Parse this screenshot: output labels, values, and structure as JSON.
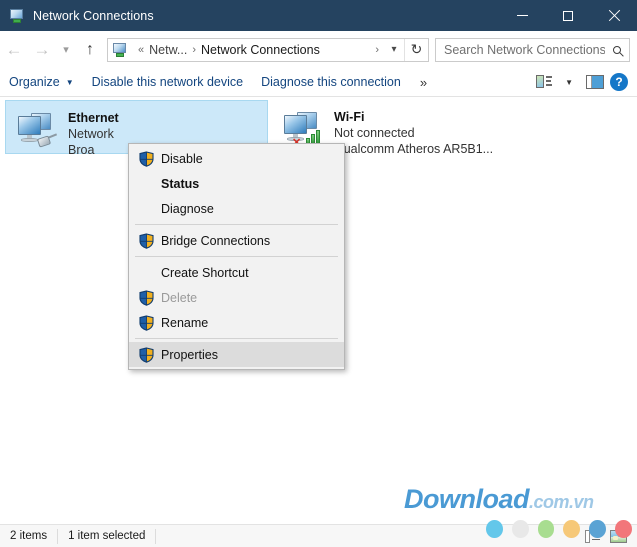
{
  "window": {
    "title": "Network Connections",
    "icon": "network-computer-icon",
    "minimize_label": "Minimize",
    "maximize_label": "Maximize",
    "close_label": "Close"
  },
  "nav": {
    "back": "back-arrow",
    "forward": "forward-arrow",
    "recent": "recent-locations-chevron",
    "up": "up-arrow",
    "breadcrumb_separator_1": "«",
    "breadcrumb_1": "Netw...",
    "breadcrumb_separator_2": "›",
    "breadcrumb_2": "Network Connections",
    "dropdown": "chevron-down-icon",
    "refresh": "refresh-icon"
  },
  "search": {
    "placeholder": "Search Network Connections",
    "value": "",
    "icon": "search-icon"
  },
  "toolbar": {
    "organize_label": "Organize",
    "disable_label": "Disable this network device",
    "diagnose_label": "Diagnose this connection",
    "overflow_label": "»",
    "view_options_label": "Change your view",
    "preview_pane_label": "Preview pane",
    "help_label": "?"
  },
  "connections": [
    {
      "name": "Ethernet",
      "status": "Network",
      "device": "Broa",
      "icon": "ethernet-connection-icon",
      "selected": true
    },
    {
      "name": "Wi-Fi",
      "status": "Not connected",
      "device": "Qualcomm Atheros AR5B1...",
      "icon": "wifi-connection-icon",
      "selected": false
    }
  ],
  "context_menu": {
    "items": [
      {
        "label": "Disable",
        "shield": true,
        "bold": false,
        "disabled": false,
        "hover": false
      },
      {
        "label": "Status",
        "shield": false,
        "bold": true,
        "disabled": false,
        "hover": false
      },
      {
        "label": "Diagnose",
        "shield": false,
        "bold": false,
        "disabled": false,
        "hover": false
      },
      {
        "separator": true
      },
      {
        "label": "Bridge Connections",
        "shield": true,
        "bold": false,
        "disabled": false,
        "hover": false
      },
      {
        "separator": true
      },
      {
        "label": "Create Shortcut",
        "shield": false,
        "bold": false,
        "disabled": false,
        "hover": false
      },
      {
        "label": "Delete",
        "shield": true,
        "bold": false,
        "disabled": true,
        "hover": false
      },
      {
        "label": "Rename",
        "shield": true,
        "bold": false,
        "disabled": false,
        "hover": false
      },
      {
        "separator": true
      },
      {
        "label": "Properties",
        "shield": true,
        "bold": false,
        "disabled": false,
        "hover": true
      }
    ]
  },
  "statusbar": {
    "item_count": "2 items",
    "selection": "1 item selected",
    "details_view_icon": "details-view-icon",
    "tiles_view_icon": "large-icons-view-icon"
  },
  "watermark": {
    "main": "Download",
    "sub": ".com.vn",
    "dots": [
      "#63c7ea",
      "#e8e8e8",
      "#a8dd90",
      "#f6c878",
      "#5aa3d4",
      "#f2767a"
    ]
  },
  "colors": {
    "titlebar": "#254360",
    "accent_link": "#13457f",
    "selection": "#cce8f9",
    "selection_border": "#a8d8f0",
    "menu_bg": "#f2f2f2",
    "menu_hover": "#dcdcdc",
    "help_blue": "#1577c8"
  }
}
